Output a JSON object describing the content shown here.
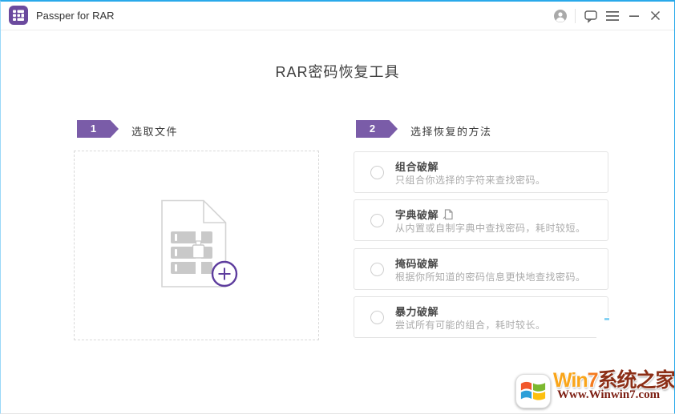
{
  "window": {
    "title": "Passper for RAR"
  },
  "titlebar": {
    "icons": [
      "app-logo-icon",
      "user-account-icon",
      "chat-icon",
      "menu-icon",
      "minimize-icon",
      "close-icon"
    ]
  },
  "colors": {
    "accent_blue": "#29a9ea",
    "brand_purple": "#6b4a9e",
    "step_purple": "#7a5ca8",
    "plus_purple": "#5e3d9e",
    "card_border": "#e4e4e4",
    "watermark_orange": "#f9a51a",
    "watermark_maroon": "#8c2f17"
  },
  "heading": "RAR密码恢复工具",
  "step1": {
    "number": "1",
    "label": "选取文件"
  },
  "step2": {
    "number": "2",
    "label": "选择恢复的方法"
  },
  "methods": [
    {
      "title": "组合破解",
      "description": "只组合你选择的字符来查找密码。"
    },
    {
      "title": "字典破解",
      "description": "从内置或自制字典中查找密码，耗时较短。"
    },
    {
      "title": "掩码破解",
      "description": "根据你所知道的密码信息更快地查找密码。"
    },
    {
      "title": "暴力破解",
      "description": "尝试所有可能的组合，耗时较长。"
    }
  ],
  "watermark": {
    "brand_win": "Win",
    "brand_7": "7",
    "brand_cn": "系统之家",
    "url": "Www.Winwin7.com"
  }
}
